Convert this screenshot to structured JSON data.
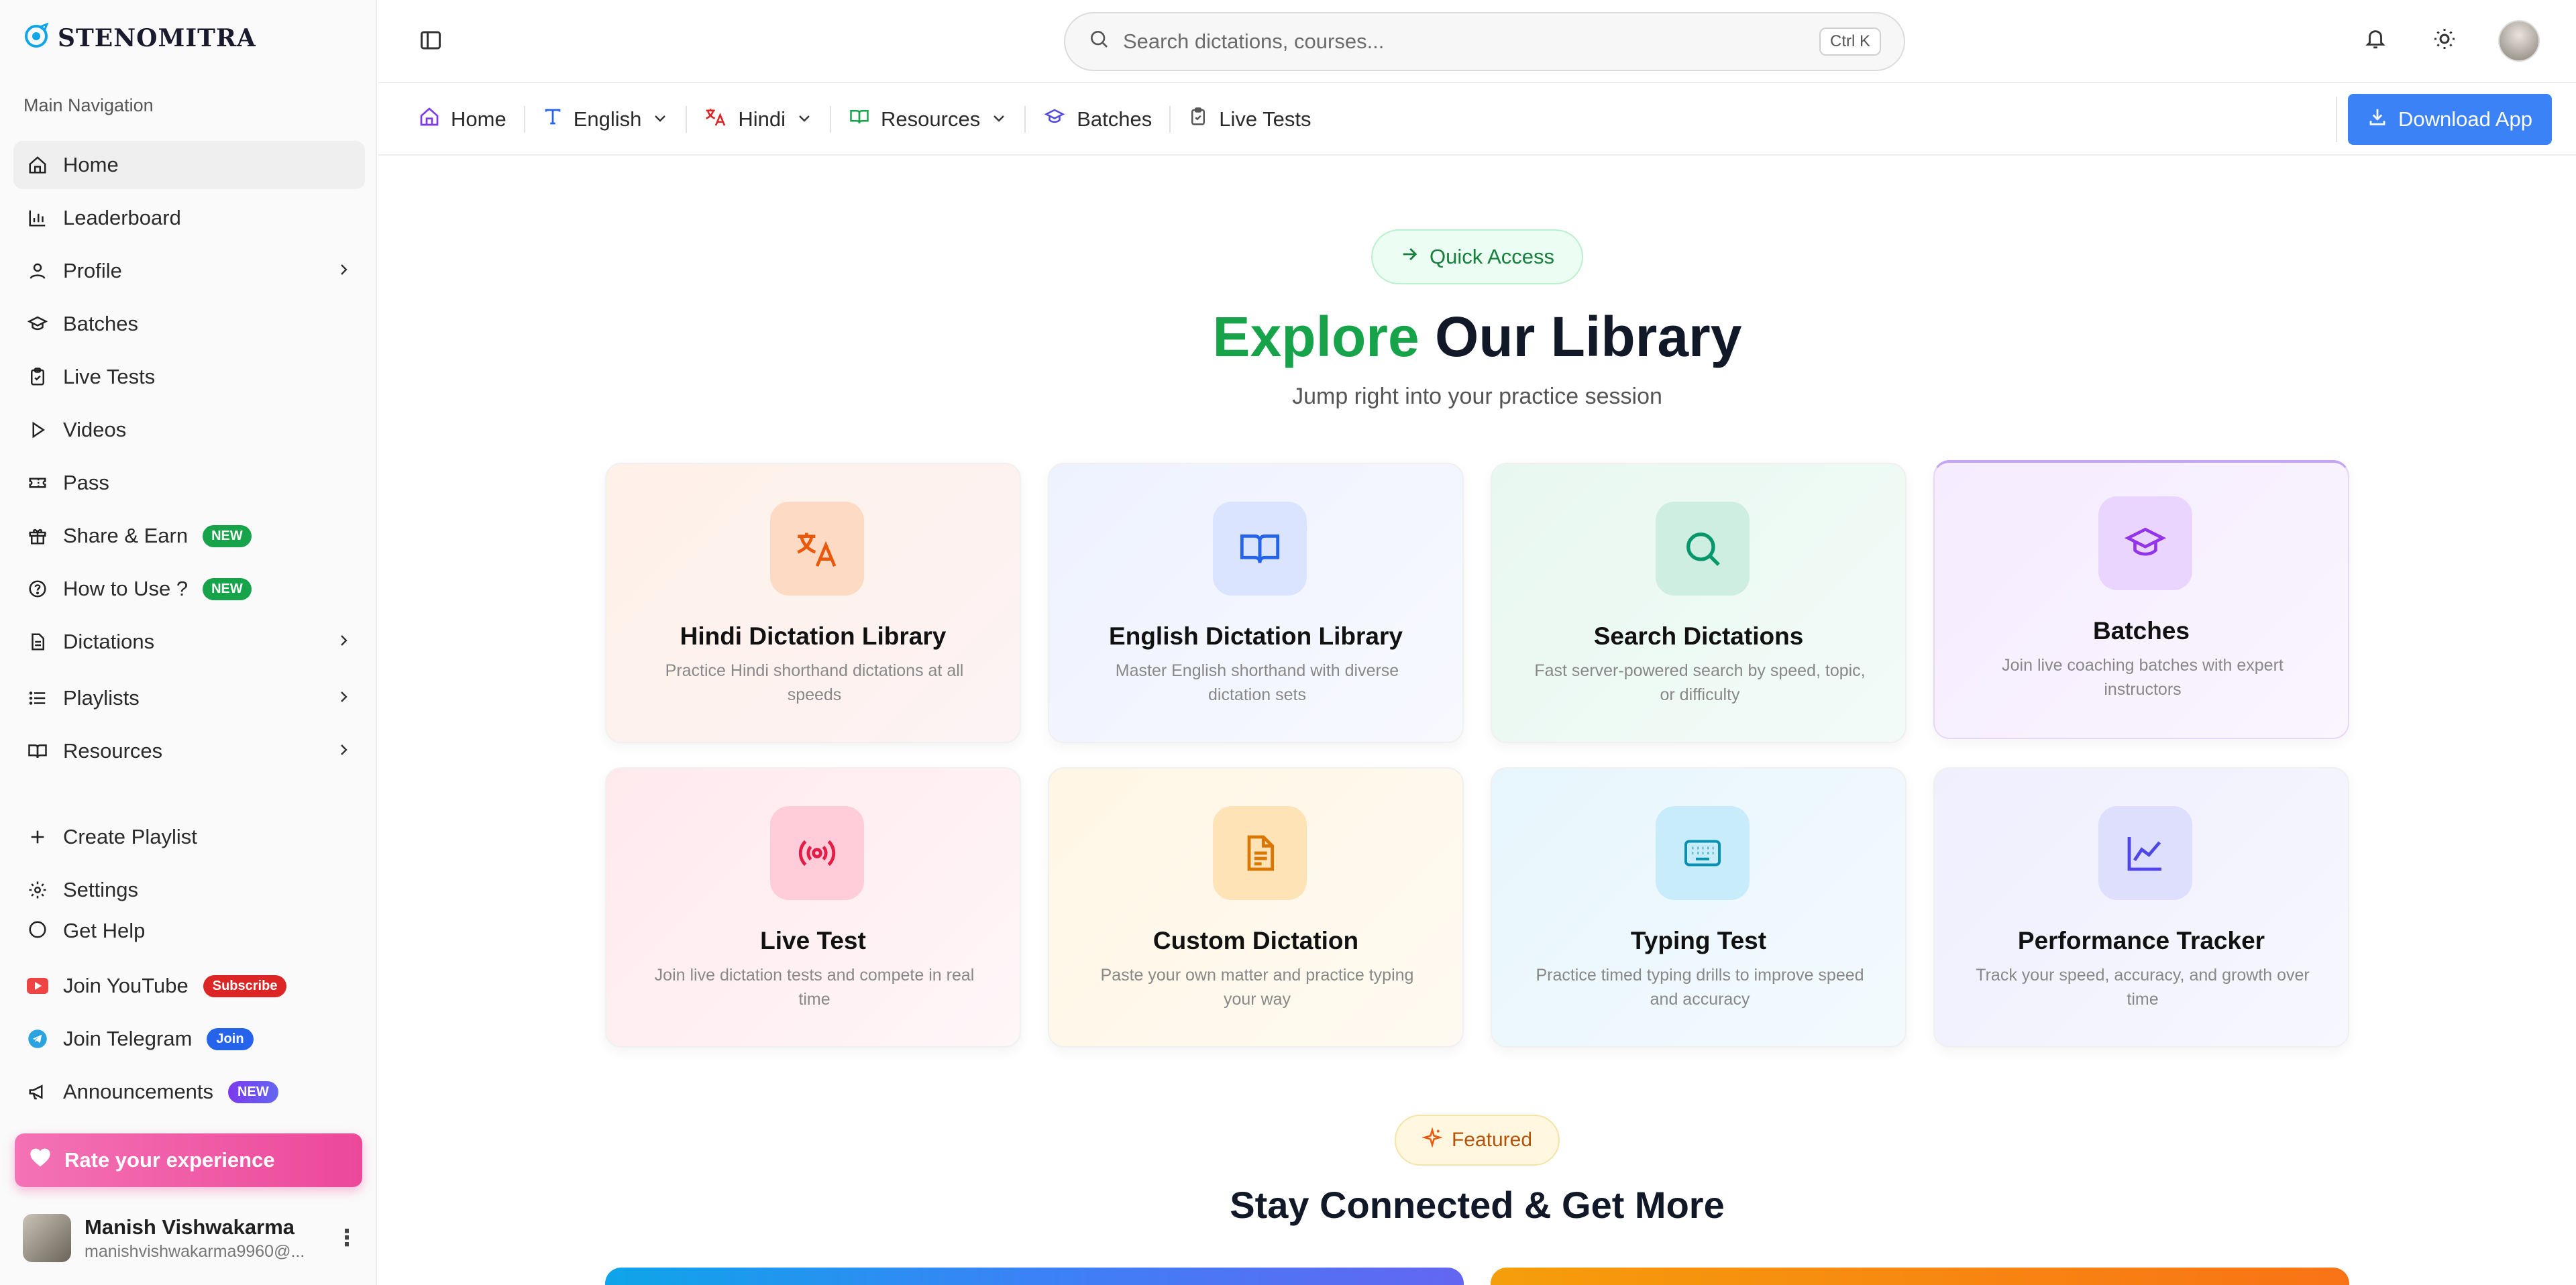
{
  "brand": {
    "name": "STENOMITRA"
  },
  "sidebar": {
    "section_label": "Main Navigation",
    "items": [
      {
        "label": "Home",
        "icon": "home-icon",
        "active": true
      },
      {
        "label": "Leaderboard",
        "icon": "bar-chart-icon"
      },
      {
        "label": "Profile",
        "icon": "user-icon",
        "chevron": true
      },
      {
        "label": "Batches",
        "icon": "graduation-cap-icon"
      },
      {
        "label": "Live Tests",
        "icon": "clipboard-check-icon"
      },
      {
        "label": "Videos",
        "icon": "play-icon"
      },
      {
        "label": "Pass",
        "icon": "ticket-icon"
      },
      {
        "label": "Share & Earn",
        "icon": "gift-icon",
        "badge": "NEW"
      },
      {
        "label": "How to Use ?",
        "icon": "help-circle-icon",
        "badge": "NEW"
      },
      {
        "label": "Dictations",
        "icon": "file-text-icon",
        "chevron": true
      },
      {
        "label": "Playlists",
        "icon": "list-icon",
        "chevron": true
      },
      {
        "label": "Resources",
        "icon": "book-open-icon",
        "chevron": true
      }
    ],
    "secondary": [
      {
        "label": "Create Playlist",
        "icon": "plus-icon"
      },
      {
        "label": "Settings",
        "icon": "gear-icon"
      },
      {
        "label": "Get Help",
        "icon": "help-icon"
      }
    ],
    "social": [
      {
        "label": "Join YouTube",
        "badge": "Subscribe",
        "icon": "youtube-icon"
      },
      {
        "label": "Join Telegram",
        "badge": "Join",
        "icon": "telegram-icon"
      },
      {
        "label": "Announcements",
        "badge": "NEW",
        "icon": "megaphone-icon"
      }
    ],
    "rate_label": "Rate your experience",
    "user": {
      "name": "Manish Vishwakarma",
      "email": "manishvishwakarma9960@..."
    }
  },
  "topbar": {
    "search_placeholder": "Search dictations, courses...",
    "shortcut": "Ctrl K"
  },
  "subnav": {
    "items": [
      {
        "label": "Home",
        "icon": "home-icon",
        "color": "#7c3aed"
      },
      {
        "label": "English",
        "icon": "type-icon",
        "color": "#2563eb",
        "dropdown": true
      },
      {
        "label": "Hindi",
        "icon": "translate-icon",
        "color": "#dc2626",
        "dropdown": true
      },
      {
        "label": "Resources",
        "icon": "book-open-icon",
        "color": "#16a34a",
        "dropdown": true
      },
      {
        "label": "Batches",
        "icon": "graduation-cap-icon",
        "color": "#4f46e5"
      },
      {
        "label": "Live Tests",
        "icon": "clipboard-check-icon",
        "color": "#555555"
      }
    ],
    "download_label": "Download App"
  },
  "main": {
    "quick_access": "Quick Access",
    "headline_accent": "Explore",
    "headline_rest": "Our Library",
    "subline": "Jump right into your practice session",
    "cards": [
      {
        "title": "Hindi Dictation Library",
        "desc": "Practice Hindi shorthand dictations at all speeds",
        "icon": "translate-icon"
      },
      {
        "title": "English Dictation Library",
        "desc": "Master English shorthand with diverse dictation sets",
        "icon": "book-open-icon"
      },
      {
        "title": "Search Dictations",
        "desc": "Fast server-powered search by speed, topic, or difficulty",
        "icon": "search-icon"
      },
      {
        "title": "Batches",
        "desc": "Join live coaching batches with expert instructors",
        "icon": "graduation-cap-icon"
      },
      {
        "title": "Live Test",
        "desc": "Join live dictation tests and compete in real time",
        "icon": "broadcast-icon"
      },
      {
        "title": "Custom Dictation",
        "desc": "Paste your own matter and practice typing your way",
        "icon": "file-text-icon"
      },
      {
        "title": "Typing Test",
        "desc": "Practice timed typing drills to improve speed and accuracy",
        "icon": "keyboard-icon"
      },
      {
        "title": "Performance Tracker",
        "desc": "Track your speed, accuracy, and growth over time",
        "icon": "line-chart-icon"
      }
    ],
    "featured": "Featured",
    "stay_connected": "Stay Connected & Get More"
  }
}
